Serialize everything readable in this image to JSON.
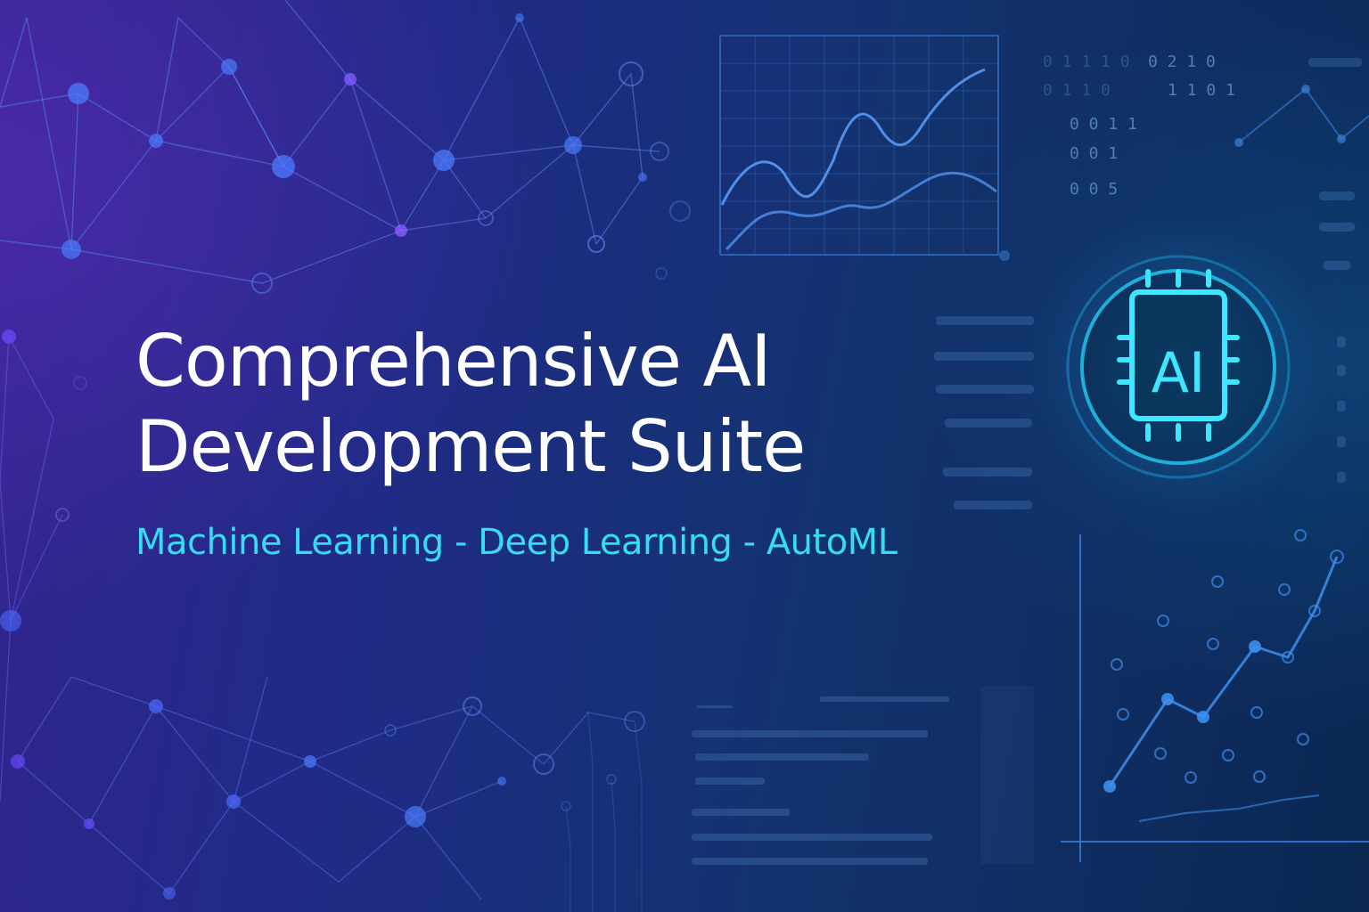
{
  "hero": {
    "title_line1": "Comprehensive AI",
    "title_line2": "Development Suite",
    "subtitle": "Machine Learning - Deep Learning - AutoML"
  },
  "badge": {
    "label": "AI",
    "icon": "ai-chip-icon"
  },
  "decor": {
    "binary_columns": [
      [
        "0 1 1 1 0",
        "0 1 1 0"
      ],
      [
        "0 2 1 0",
        "1 1 0 1"
      ],
      [
        "0 0 1 1",
        "0 0 1",
        "0 0 5"
      ]
    ]
  },
  "colors": {
    "title": "#ffffff",
    "subtitle": "#35dcf2",
    "accent": "#3fe6ff",
    "network": "#4a74e6"
  }
}
